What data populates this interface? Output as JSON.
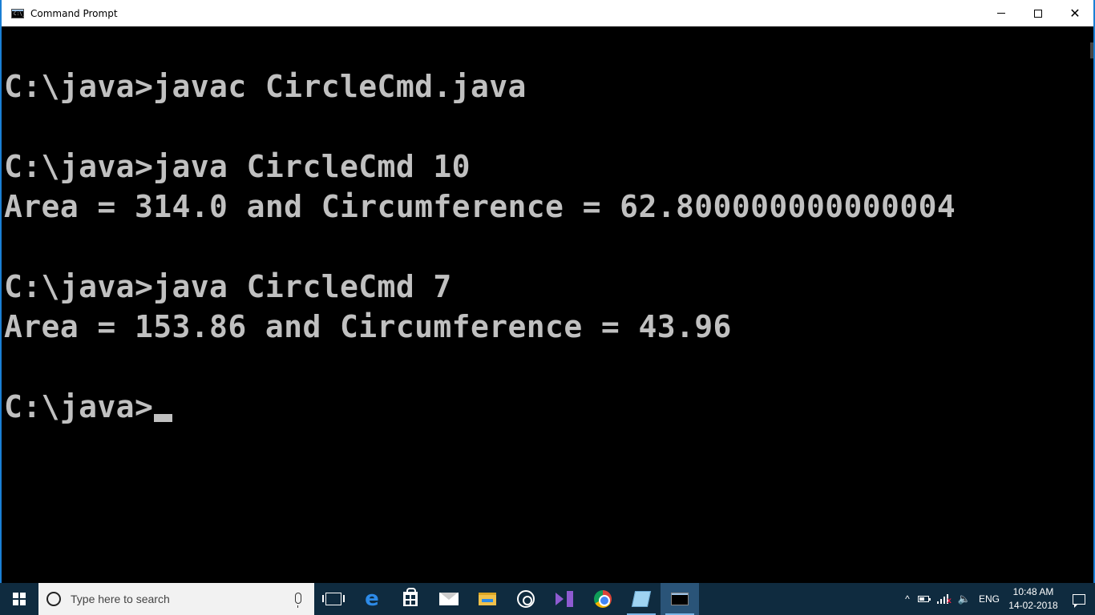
{
  "window": {
    "title": "Command Prompt",
    "icon_label": "C:\\_",
    "controls": {
      "minimize": "minimize-icon",
      "maximize": "maximize-icon",
      "close": "✕"
    }
  },
  "console": {
    "lines": [
      "",
      "C:\\java>javac CircleCmd.java",
      "",
      "C:\\java>java CircleCmd 10",
      "Area = 314.0 and Circumference = 62.800000000000004",
      "",
      "C:\\java>java CircleCmd 7",
      "Area = 153.86 and Circumference = 43.96",
      "",
      "C:\\java>"
    ]
  },
  "taskbar": {
    "search_placeholder": "Type here to search",
    "apps": [
      {
        "name": "task-view-icon"
      },
      {
        "name": "edge-icon",
        "glyph": "e"
      },
      {
        "name": "store-icon"
      },
      {
        "name": "mail-icon"
      },
      {
        "name": "file-explorer-icon"
      },
      {
        "name": "groove-icon"
      },
      {
        "name": "visual-studio-icon"
      },
      {
        "name": "chrome-icon"
      },
      {
        "name": "notes-icon"
      },
      {
        "name": "command-prompt-icon"
      }
    ],
    "tray": {
      "chevron": "^",
      "language": "ENG",
      "time": "10:48 AM",
      "date": "14-02-2018"
    }
  }
}
